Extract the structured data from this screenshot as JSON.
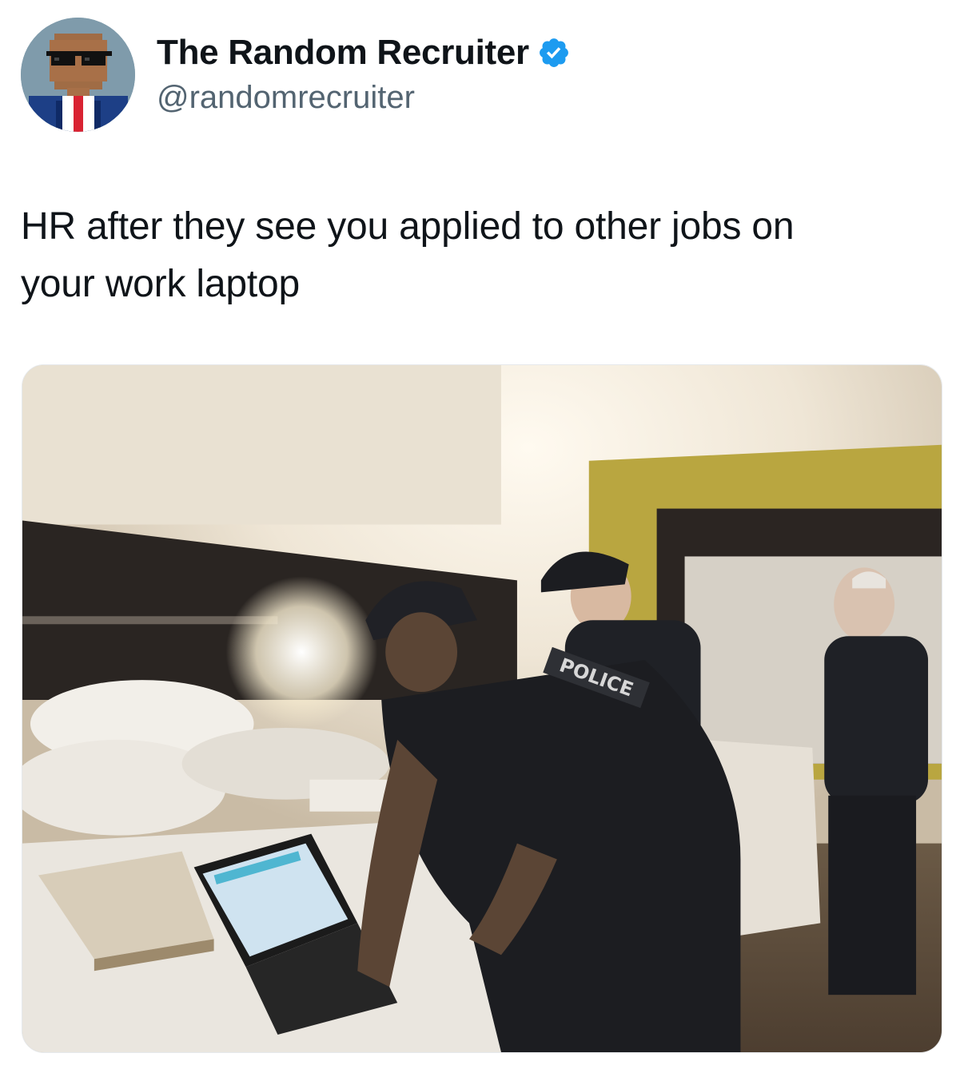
{
  "post": {
    "author": {
      "display_name": "The Random Recruiter",
      "handle": "@randomrecruiter",
      "verified": true,
      "avatar_icon": "pixel-avatar-sunglasses"
    },
    "text_line1": "HR after they see you applied to other jobs on",
    "text_line2": "your work laptop",
    "media": {
      "type": "photo",
      "vest_label": "POLICE"
    }
  },
  "colors": {
    "verified_badge": "#1d9bf0",
    "handle_text": "#536471",
    "body_text": "#0f1419"
  }
}
